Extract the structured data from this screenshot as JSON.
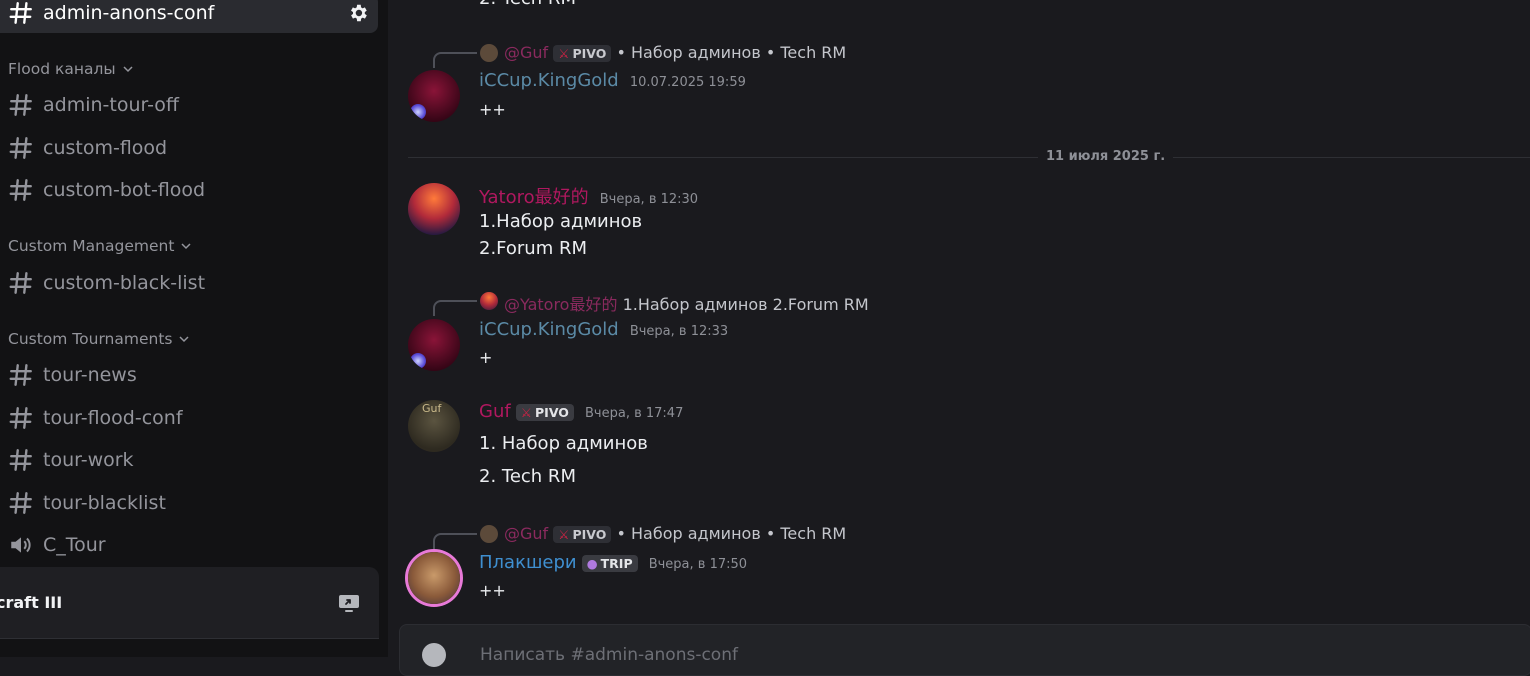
{
  "sidebar": {
    "active_channel": "admin-anons-conf",
    "categories": [
      {
        "label": "Flood каналы",
        "channels": [
          "admin-tour-off",
          "custom-flood",
          "custom-bot-flood"
        ]
      },
      {
        "label": "Custom Management",
        "channels": [
          "custom-black-list"
        ]
      },
      {
        "label": "Custom Tournaments",
        "channels": [
          "tour-news",
          "tour-flood-conf",
          "tour-work",
          "tour-blacklist"
        ]
      }
    ],
    "voice_channel": "C_Tour",
    "server_name": "craft III"
  },
  "chat": {
    "top_cut_text": "2. Tech RM",
    "messages": [
      {
        "reply_mention": "@Guf",
        "reply_tag": "PIVO",
        "reply_text": "• Набор админов  • Tech RM",
        "author": "iCCup.KingGold",
        "timestamp": "10.07.2025 19:59",
        "text": "++"
      },
      {
        "author": "Yatoro最好的",
        "timestamp": "Вчера, в 12:30",
        "line1": "1.Набор админов",
        "line2": "2.Forum RM"
      },
      {
        "reply_mention": "@Yatoro最好的",
        "reply_text": "1.Набор админов  2.Forum RM",
        "author": "iCCup.KingGold",
        "timestamp": "Вчера, в 12:33",
        "text": "+"
      },
      {
        "author": "Guf",
        "tag": "PIVO",
        "timestamp": "Вчера, в 17:47",
        "line1": "1. Набор админов",
        "line2": "2. Tech RM"
      },
      {
        "reply_mention": "@Guf",
        "reply_tag": "PIVO",
        "reply_text": "• Набор админов  • Tech RM",
        "author": "Плакшери",
        "tag": "TRIP",
        "timestamp": "Вчера, в 17:50",
        "text": "++"
      }
    ],
    "date_divider": "11 июля 2025 г.",
    "input_placeholder": "Написать #admin-anons-conf"
  }
}
